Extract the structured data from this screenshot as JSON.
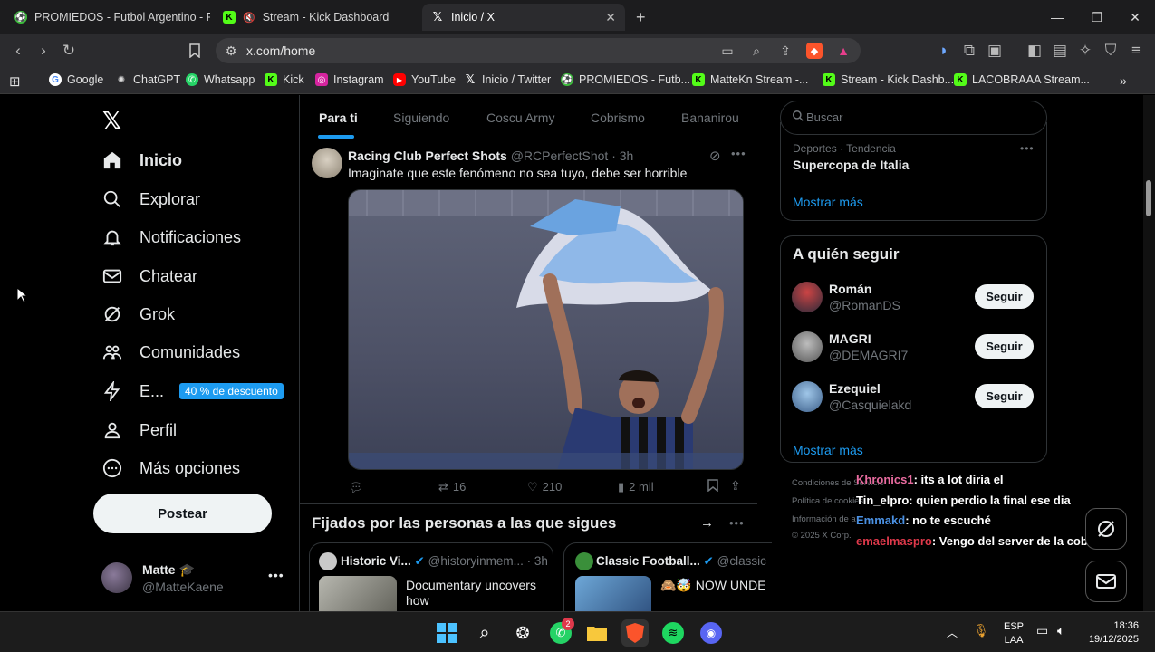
{
  "tabs": [
    {
      "title": "PROMIEDOS - Futbol Argentino - Fix",
      "icon": "promiedos-icon"
    },
    {
      "title": "Stream - Kick Dashboard",
      "icon": "kick-icon"
    },
    {
      "title": "Inicio / X",
      "icon": "x-icon"
    }
  ],
  "address": {
    "url": "x.com/home"
  },
  "bookmarks": [
    "Google",
    "ChatGPT",
    "Whatsapp",
    "Kick",
    "Instagram",
    "YouTube",
    "Inicio / Twitter",
    "PROMIEDOS - Futb...",
    "MatteKn Stream -...",
    "Stream - Kick Dashb...",
    "LACOBRAAA Stream..."
  ],
  "nav": {
    "items": [
      "Inicio",
      "Explorar",
      "Notificaciones",
      "Chatear",
      "Grok",
      "Comunidades",
      "E...",
      "Perfil",
      "Más opciones"
    ],
    "discount": "40 % de descuento",
    "post": "Postear",
    "user": {
      "name": "Matte 🎓",
      "handle": "@MatteKaene"
    }
  },
  "feed_tabs": [
    "Para ti",
    "Siguiendo",
    "Coscu Army",
    "Cobrismo",
    "Bananirou"
  ],
  "tweet": {
    "author": "Racing Club Perfect Shots",
    "handle": "@RCPerfectShot",
    "time": "· 3h",
    "text": "Imaginate que este fenómeno no sea tuyo, debe ser horrible",
    "retweets": "16",
    "likes": "210",
    "views": "2 mil"
  },
  "pinned": {
    "title": "Fijados por las personas a las que sigues",
    "cards": [
      {
        "name": "Historic Vi...",
        "handle": "@historyinmem...",
        "time": "· 3h",
        "text": "Documentary uncovers how"
      },
      {
        "name": "Classic Football...",
        "handle": "@classic",
        "text": "🙈🤯 NOW UNDE"
      }
    ]
  },
  "search": {
    "placeholder": "Buscar"
  },
  "trend": {
    "category": "Deportes · Tendencia",
    "title": "Supercopa de Italia",
    "more": "Mostrar más"
  },
  "who_to_follow": {
    "title": "A quién seguir",
    "people": [
      {
        "name": "Román",
        "handle": "@RomanDS_",
        "button": "Seguir"
      },
      {
        "name": "MAGRI",
        "handle": "@DEMAGRI7",
        "button": "Seguir"
      },
      {
        "name": "Ezequiel",
        "handle": "@Casquielakd",
        "button": "Seguir"
      }
    ],
    "more": "Mostrar más"
  },
  "footer": [
    "Condiciones de Servicio",
    "Política de cookies",
    "Información de a",
    "© 2025 X Corp."
  ],
  "chat": [
    {
      "user": "Khronics1",
      "msg": ": its a lot diria el",
      "color": "#e86b9f"
    },
    {
      "user": "Tin_elpro",
      "msg": ": quien perdio la final ese dia",
      "color": "#ffffff"
    },
    {
      "user": "Emmakd",
      "msg": ": no te escuché",
      "color": "#4a90e2"
    },
    {
      "user": "emaelmaspro",
      "msg": ": Vengo del server de la cobrix",
      "color": "#e0394b"
    }
  ],
  "taskbar": {
    "lang": "ESP",
    "region": "LAA",
    "time": "18:36",
    "date": "19/12/2025",
    "badge": "2"
  },
  "colors": {
    "accent": "#1d9bf0",
    "bg": "#000000",
    "chrome": "#2b2b2e"
  }
}
